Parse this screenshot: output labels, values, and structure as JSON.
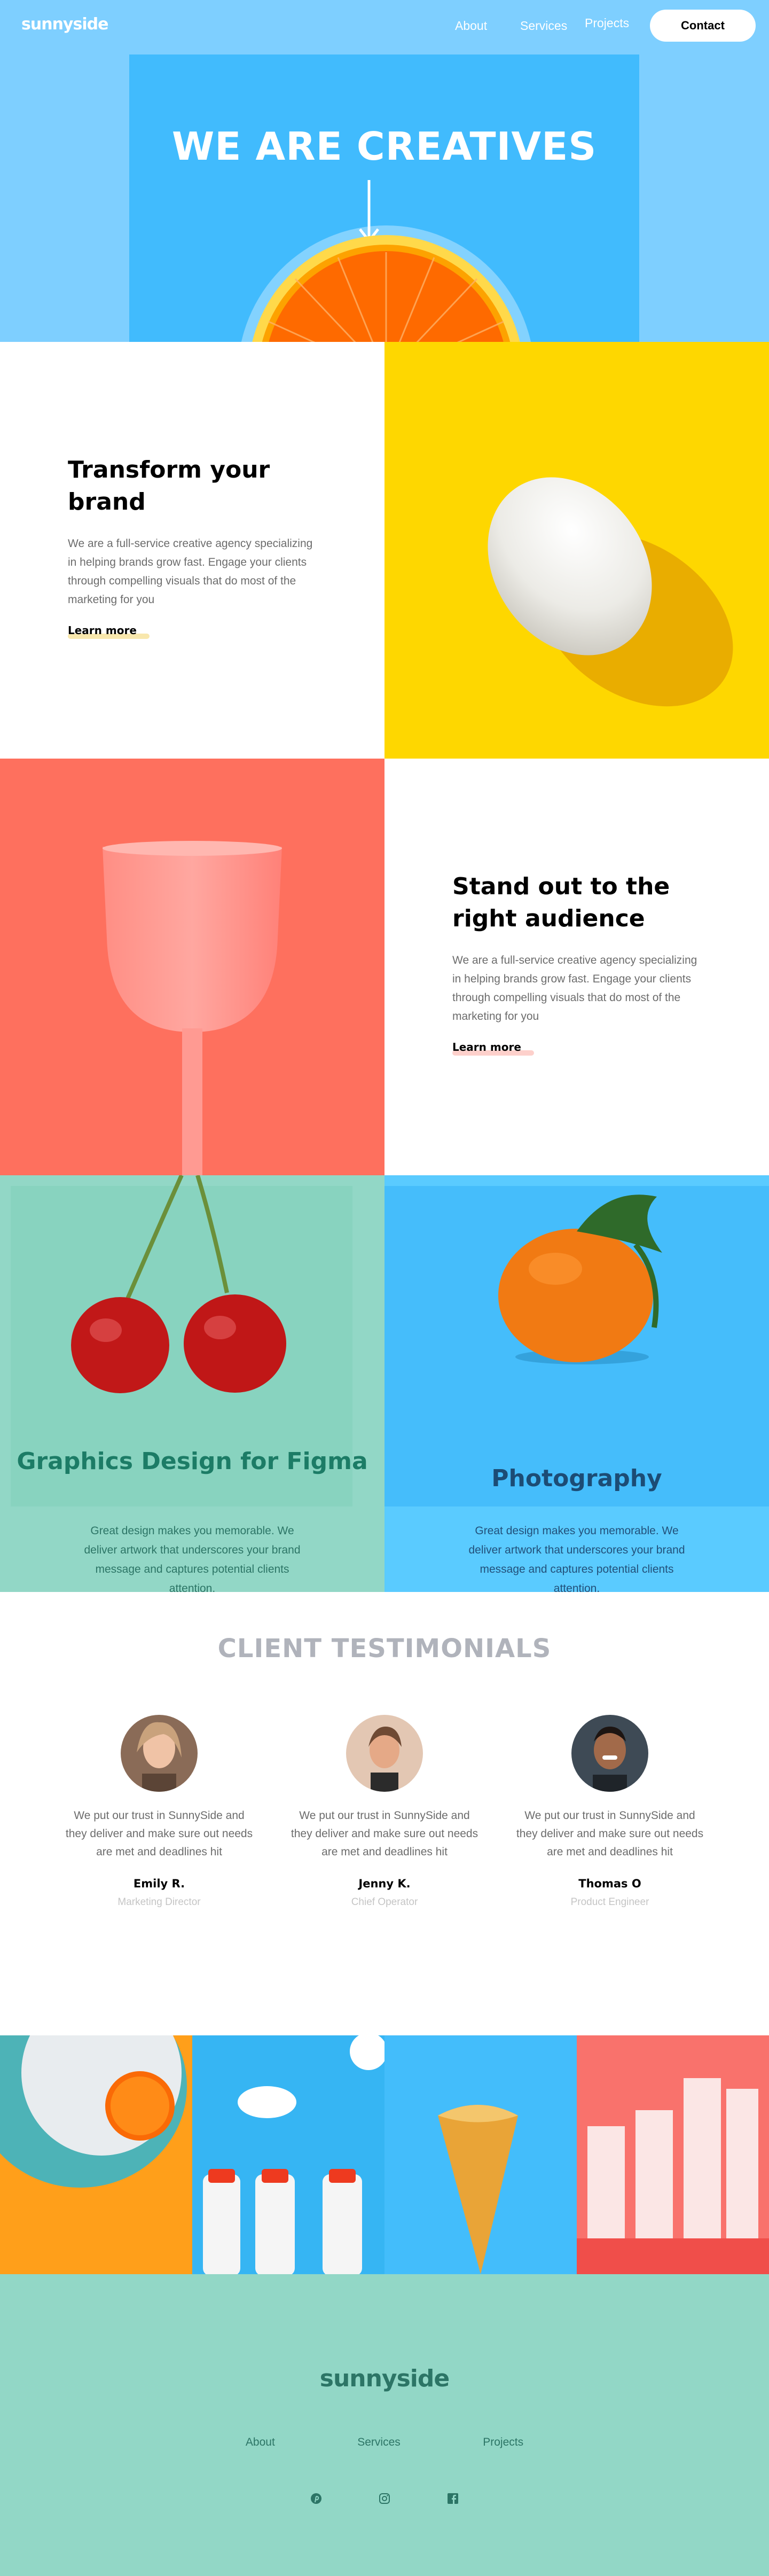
{
  "header": {
    "logo": "sunnyside",
    "nav": [
      "About",
      "Services",
      "Projects"
    ],
    "contact": "Contact"
  },
  "hero": {
    "title": "WE ARE CREATIVES",
    "arrow_icon": "arrow-down-icon"
  },
  "features": [
    {
      "title": "Transform your brand",
      "body": "We are a full-service creative agency specializing in helping brands grow fast. Engage your clients through compelling visuals that do most of the marketing for you",
      "link": "Learn more",
      "highlight_color": "#f8e7ad"
    },
    {
      "title": "Stand out to the right audience",
      "body": "We are a full-service creative agency specializing in helping brands grow fast. Engage your clients through compelling visuals that do most of the marketing for you",
      "link": "Learn more",
      "highlight_color": "#fdd0cb"
    }
  ],
  "services": [
    {
      "title": "Graphics Design for Figma",
      "body": "Great design makes you memorable. We deliver artwork that underscores your brand message and captures potential clients attention.",
      "title_color": "#1c7c66",
      "body_color": "#2c7566"
    },
    {
      "title": "Photography",
      "body": "Great design makes you memorable. We deliver artwork that underscores your brand message and captures potential clients attention.",
      "title_color": "#1c4c75",
      "body_color": "#22507a"
    }
  ],
  "testimonials": {
    "heading": "CLIENT TESTIMONIALS",
    "items": [
      {
        "quote": "We put our trust in SunnySide and they deliver and make sure out needs are met and deadlines hit",
        "name": "Emily R.",
        "role": "Marketing Director"
      },
      {
        "quote": "We put our trust in SunnySide and they deliver and make sure out needs are met and deadlines hit",
        "name": "Jenny K.",
        "role": "Chief Operator"
      },
      {
        "quote": "We put our trust in SunnySide and they deliver and make sure out needs are met and deadlines hit",
        "name": "Thomas O",
        "role": "Product Engineer"
      }
    ]
  },
  "footer": {
    "logo": "sunnyside",
    "links": [
      "About",
      "Services",
      "Projects"
    ],
    "social_icons": [
      "pinterest-icon",
      "instagram-icon",
      "facebook-icon"
    ]
  },
  "colors": {
    "hero_bg": "#7ecfff",
    "hero_panel": "#41bbfd",
    "egg_bg": "#fed700",
    "cup_bg": "#fe705e",
    "service_green": "#92d7c6",
    "service_blue": "#5acbff",
    "footer_bg": "#92d7c6"
  }
}
